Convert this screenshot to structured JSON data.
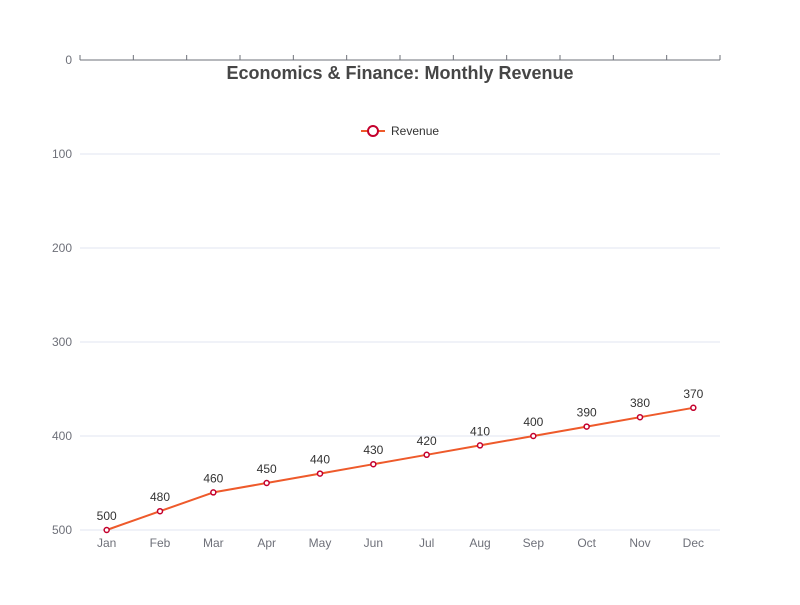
{
  "chart_data": {
    "type": "line",
    "title": "Economics & Finance: Monthly Revenue",
    "categories": [
      "Jan",
      "Feb",
      "Mar",
      "Apr",
      "May",
      "Jun",
      "Jul",
      "Aug",
      "Sep",
      "Oct",
      "Nov",
      "Dec"
    ],
    "series": [
      {
        "name": "Revenue",
        "values": [
          500,
          480,
          460,
          450,
          440,
          430,
          420,
          410,
          400,
          390,
          380,
          370
        ],
        "line_color": "#ee5a2b",
        "marker_color": "#c4002d"
      }
    ],
    "y_axis": {
      "min": 0,
      "max": 500,
      "inverse": true,
      "ticks": [
        0,
        100,
        200,
        300,
        400,
        500
      ]
    },
    "xlabel": "",
    "ylabel": "",
    "grid": true,
    "legend_position": "top-center",
    "show_data_labels": true
  }
}
